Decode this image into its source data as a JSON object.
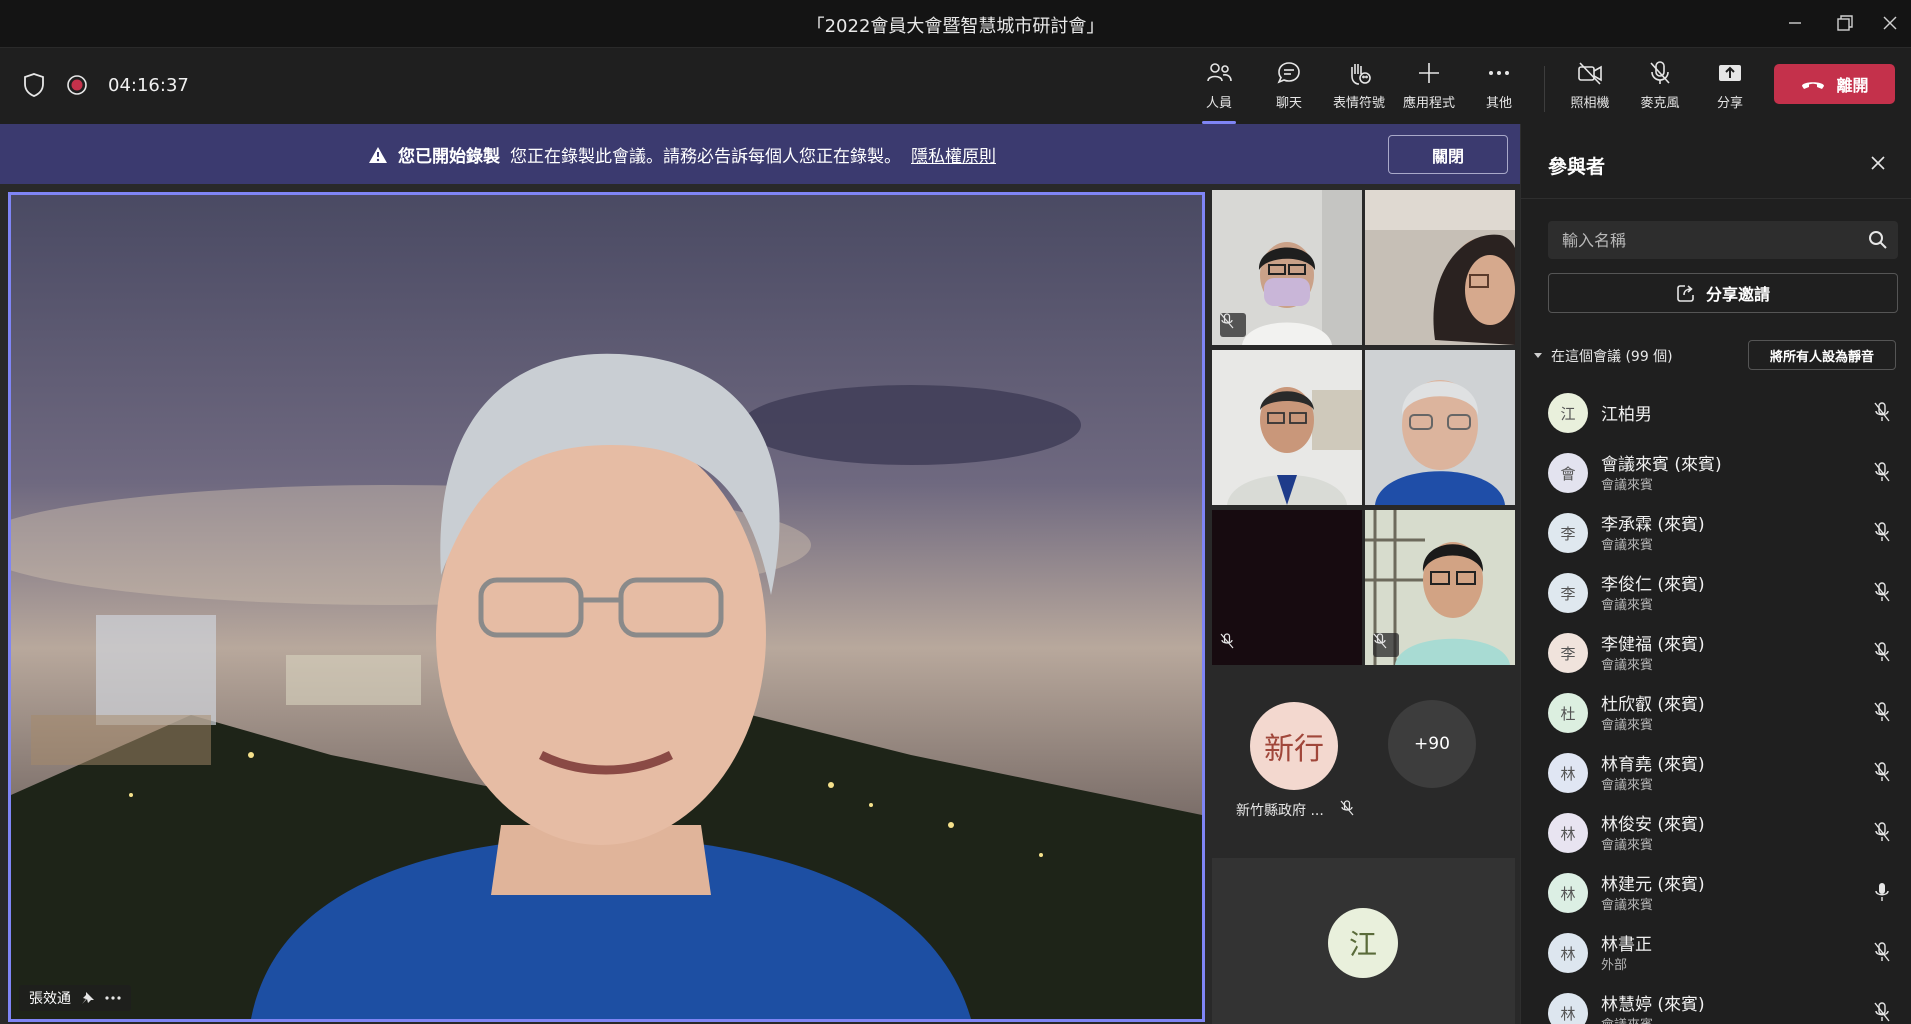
{
  "window": {
    "title": "「2022會員大會暨智慧城市研討會」"
  },
  "toolbar": {
    "timer": "04:16:37",
    "buttons": [
      {
        "label": "人員",
        "icon": "people-icon"
      },
      {
        "label": "聊天",
        "icon": "chat-icon"
      },
      {
        "label": "表情符號",
        "icon": "emoji-hand-icon"
      },
      {
        "label": "應用程式",
        "icon": "plus-icon"
      },
      {
        "label": "其他",
        "icon": "more-icon"
      },
      {
        "label": "照相機",
        "icon": "camera-off-icon"
      },
      {
        "label": "麥克風",
        "icon": "mic-off-icon"
      },
      {
        "label": "分享",
        "icon": "share-icon"
      }
    ],
    "leave_label": "離開"
  },
  "banner": {
    "title": "您已開始錄製",
    "message": "您正在錄製此會議。請務必告訴每個人您正在錄製。",
    "link": "隱私權原則",
    "close_label": "關閉"
  },
  "stage": {
    "main_speaker": "張效通",
    "avatar_tile": {
      "initials": "新行",
      "name": "新竹縣政府 ..."
    },
    "overflow_count": "+90",
    "bottom_avatar": "江"
  },
  "panel": {
    "title": "參與者",
    "search_placeholder": "輸入名稱",
    "share_invite": "分享邀請",
    "section_label": "在這個會議 (99 個)",
    "mute_all": "將所有人設為靜音",
    "participants": [
      {
        "initial": "江",
        "name": "江柏男",
        "role": "",
        "avatar_color": "#e9f0dc",
        "mic": "off"
      },
      {
        "initial": "會",
        "name": "會議來賓 (來賓)",
        "role": "會議來賓",
        "avatar_color": "#e3e3ef",
        "mic": "off"
      },
      {
        "initial": "李",
        "name": "李承霖 (來賓)",
        "role": "會議來賓",
        "avatar_color": "#dfe8ef",
        "mic": "off"
      },
      {
        "initial": "李",
        "name": "李俊仁 (來賓)",
        "role": "會議來賓",
        "avatar_color": "#dfe8ef",
        "mic": "off"
      },
      {
        "initial": "李",
        "name": "李健福 (來賓)",
        "role": "會議來賓",
        "avatar_color": "#f0e3dc",
        "mic": "off"
      },
      {
        "initial": "杜",
        "name": "杜欣叡 (來賓)",
        "role": "會議來賓",
        "avatar_color": "#dcefe0",
        "mic": "off"
      },
      {
        "initial": "林",
        "name": "林育堯 (來賓)",
        "role": "會議來賓",
        "avatar_color": "#e0e6f3",
        "mic": "off"
      },
      {
        "initial": "林",
        "name": "林俊安 (來賓)",
        "role": "會議來賓",
        "avatar_color": "#e8e4f1",
        "mic": "off"
      },
      {
        "initial": "林",
        "name": "林建元 (來賓)",
        "role": "會議來賓",
        "avatar_color": "#dcefe4",
        "mic": "on"
      },
      {
        "initial": "林",
        "name": "林書正",
        "role": "外部",
        "avatar_color": "#dde6ef",
        "mic": "off"
      },
      {
        "initial": "林",
        "name": "林慧婷 (來賓)",
        "role": "會議來賓",
        "avatar_color": "#dde6ef",
        "mic": "off"
      }
    ]
  },
  "colors": {
    "accent": "#7f85f5",
    "leave": "#c4314b",
    "banner": "#3b3a6f"
  }
}
